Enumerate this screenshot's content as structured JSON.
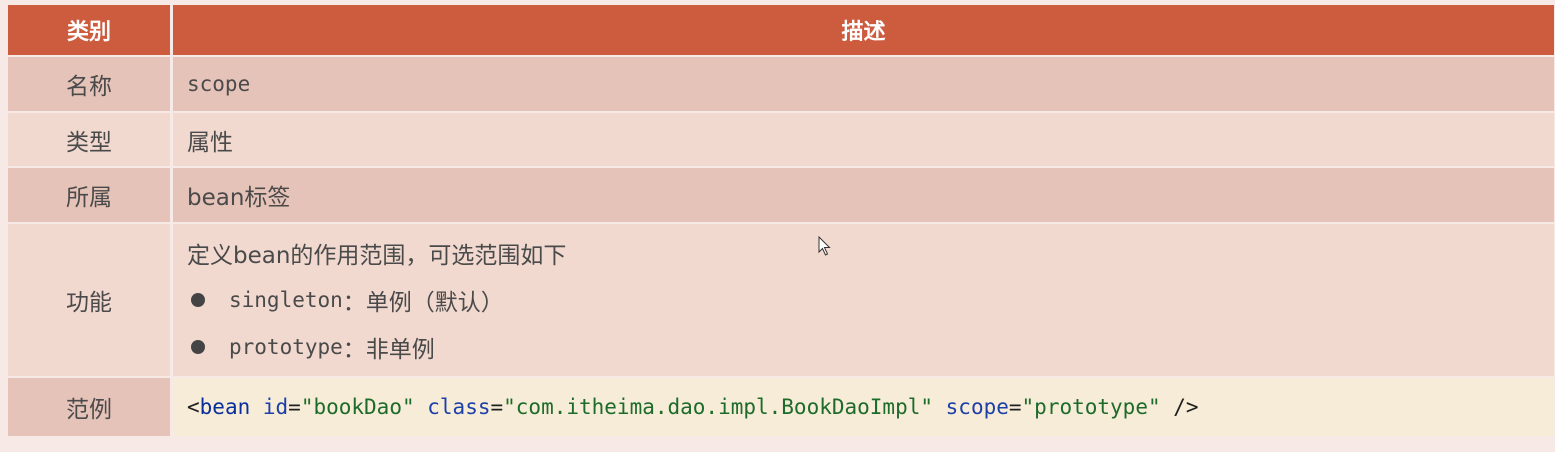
{
  "header": {
    "col1": "类别",
    "col2": "描述"
  },
  "rows": {
    "name": {
      "label": "名称",
      "value": "scope"
    },
    "type": {
      "label": "类型",
      "value": "属性"
    },
    "belongs": {
      "label": "所属",
      "value": "bean标签"
    },
    "function": {
      "label": "功能",
      "intro": "定义bean的作用范围，可选范围如下",
      "items": [
        {
          "key": "singleton",
          "desc": "：单例（默认）"
        },
        {
          "key": "prototype",
          "desc": "：非单例"
        }
      ]
    },
    "example": {
      "label": "范例",
      "code": {
        "open": "<",
        "tag": "bean",
        "attr1": " id",
        "eq1": "=",
        "val1": "\"bookDao\"",
        "attr2": " class",
        "eq2": "=",
        "val2": "\"com.itheima.dao.impl.BookDaoImpl\"",
        "attr3": " scope",
        "eq3": "=",
        "val3": "\"prototype\"",
        "close": " />"
      }
    }
  },
  "colors": {
    "header_bg": "#cd5b3e",
    "row_dark": "#e6c3b8",
    "row_light": "#f1d9d0",
    "code_bg": "#f7ecd7"
  }
}
